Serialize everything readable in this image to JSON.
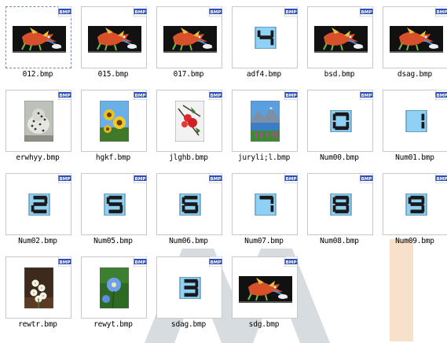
{
  "files": [
    {
      "name": "012.bmp",
      "thumb": "dragon-art",
      "badge": "BMP",
      "selected": true
    },
    {
      "name": "015.bmp",
      "thumb": "dragon-art",
      "badge": "BMP"
    },
    {
      "name": "017.bmp",
      "thumb": "dragon-art",
      "badge": "BMP"
    },
    {
      "name": "adf4.bmp",
      "thumb": "digit",
      "digit": "4",
      "badge": "BMP"
    },
    {
      "name": "bsd.bmp",
      "thumb": "dragon-art",
      "badge": "BMP"
    },
    {
      "name": "dsag.bmp",
      "thumb": "dragon-art",
      "badge": "BMP"
    },
    {
      "name": "erwhyy.bmp",
      "thumb": "leopard-photo",
      "badge": "BMP"
    },
    {
      "name": "hgkf.bmp",
      "thumb": "sunflower-photo",
      "badge": "BMP"
    },
    {
      "name": "jlghb.bmp",
      "thumb": "berries-photo",
      "badge": "BMP"
    },
    {
      "name": "juryli;l.bmp",
      "thumb": "lake-photo",
      "badge": "BMP"
    },
    {
      "name": "Num00.bmp",
      "thumb": "digit",
      "digit": "0",
      "badge": "BMP"
    },
    {
      "name": "Num01.bmp",
      "thumb": "digit",
      "digit": "1",
      "badge": "BMP"
    },
    {
      "name": "Num02.bmp",
      "thumb": "digit",
      "digit": "2",
      "badge": "BMP"
    },
    {
      "name": "Num05.bmp",
      "thumb": "digit",
      "digit": "5",
      "badge": "BMP"
    },
    {
      "name": "Num06.bmp",
      "thumb": "digit",
      "digit": "6",
      "badge": "BMP"
    },
    {
      "name": "Num07.bmp",
      "thumb": "digit",
      "digit": "7",
      "badge": "BMP"
    },
    {
      "name": "Num08.bmp",
      "thumb": "digit",
      "digit": "8",
      "badge": "BMP"
    },
    {
      "name": "Num09.bmp",
      "thumb": "digit",
      "digit": "9",
      "badge": "BMP"
    },
    {
      "name": "rewtr.bmp",
      "thumb": "white-flowers-photo",
      "badge": "BMP"
    },
    {
      "name": "rewyt.bmp",
      "thumb": "blue-flower-photo",
      "badge": "BMP"
    },
    {
      "name": "sdag.bmp",
      "thumb": "digit",
      "digit": "3",
      "badge": "BMP"
    },
    {
      "name": "sdg.bmp",
      "thumb": "dragon-art",
      "badge": "BMP"
    }
  ],
  "colors": {
    "badge_bg": "#2a4fc4",
    "digit_tile": "#8fd0f5",
    "digit_stroke": "#1a1a1a",
    "dragon_bg": "#111111",
    "watermark_gray": "#8a9aa6",
    "watermark_orange": "#f3c9a0"
  }
}
